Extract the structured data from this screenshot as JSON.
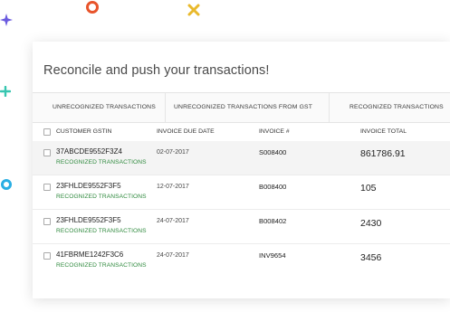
{
  "page": {
    "title": "Reconcile and push your transactions!"
  },
  "tabs": [
    {
      "label": "UNRECOGNIZED TRANSACTIONS"
    },
    {
      "label": "UNRECOGNIZED TRANSACTIONS FROM GST"
    },
    {
      "label": "RECOGNIZED TRANSACTIONS"
    }
  ],
  "table": {
    "columns": [
      "CUSTOMER GSTIN",
      "INVOICE DUE DATE",
      "INVOICE #",
      "INVOICE TOTAL"
    ],
    "rows": [
      {
        "gstin": "37ABCDE9552F3Z4",
        "status": "RECOGNIZED TRANSACTIONS",
        "due_date": "02-07-2017",
        "invoice_no": "S008400",
        "total": "861786.91",
        "highlighted": true
      },
      {
        "gstin": "23FHLDE9552F3F5",
        "status": "RECOGNIZED TRANSACTIONS",
        "due_date": "12-07-2017",
        "invoice_no": "B008400",
        "total": "105",
        "highlighted": false
      },
      {
        "gstin": "23FHLDE9552F3F5",
        "status": "RECOGNIZED TRANSACTIONS",
        "due_date": "24-07-2017",
        "invoice_no": "B008402",
        "total": "2430",
        "highlighted": false
      },
      {
        "gstin": "41FBRME1242F3C6",
        "status": "RECOGNIZED TRANSACTIONS",
        "due_date": "24-07-2017",
        "invoice_no": "INV9654",
        "total": "3456",
        "highlighted": false
      }
    ]
  },
  "colors": {
    "status_green": "#2f8a3e",
    "title_gray": "#4a4a4a",
    "row_highlight": "#f4f4f4",
    "confetti_red": "#e8542b",
    "confetti_yellow": "#e9b92c",
    "confetti_purple": "#6a5adf",
    "confetti_teal": "#37c6b0",
    "confetti_blue": "#29aee3"
  },
  "icons": {
    "decorative": [
      "ring-icon",
      "sparkle-icon",
      "cross-icon",
      "plus-icon"
    ],
    "row_select": "checkbox-icon"
  }
}
